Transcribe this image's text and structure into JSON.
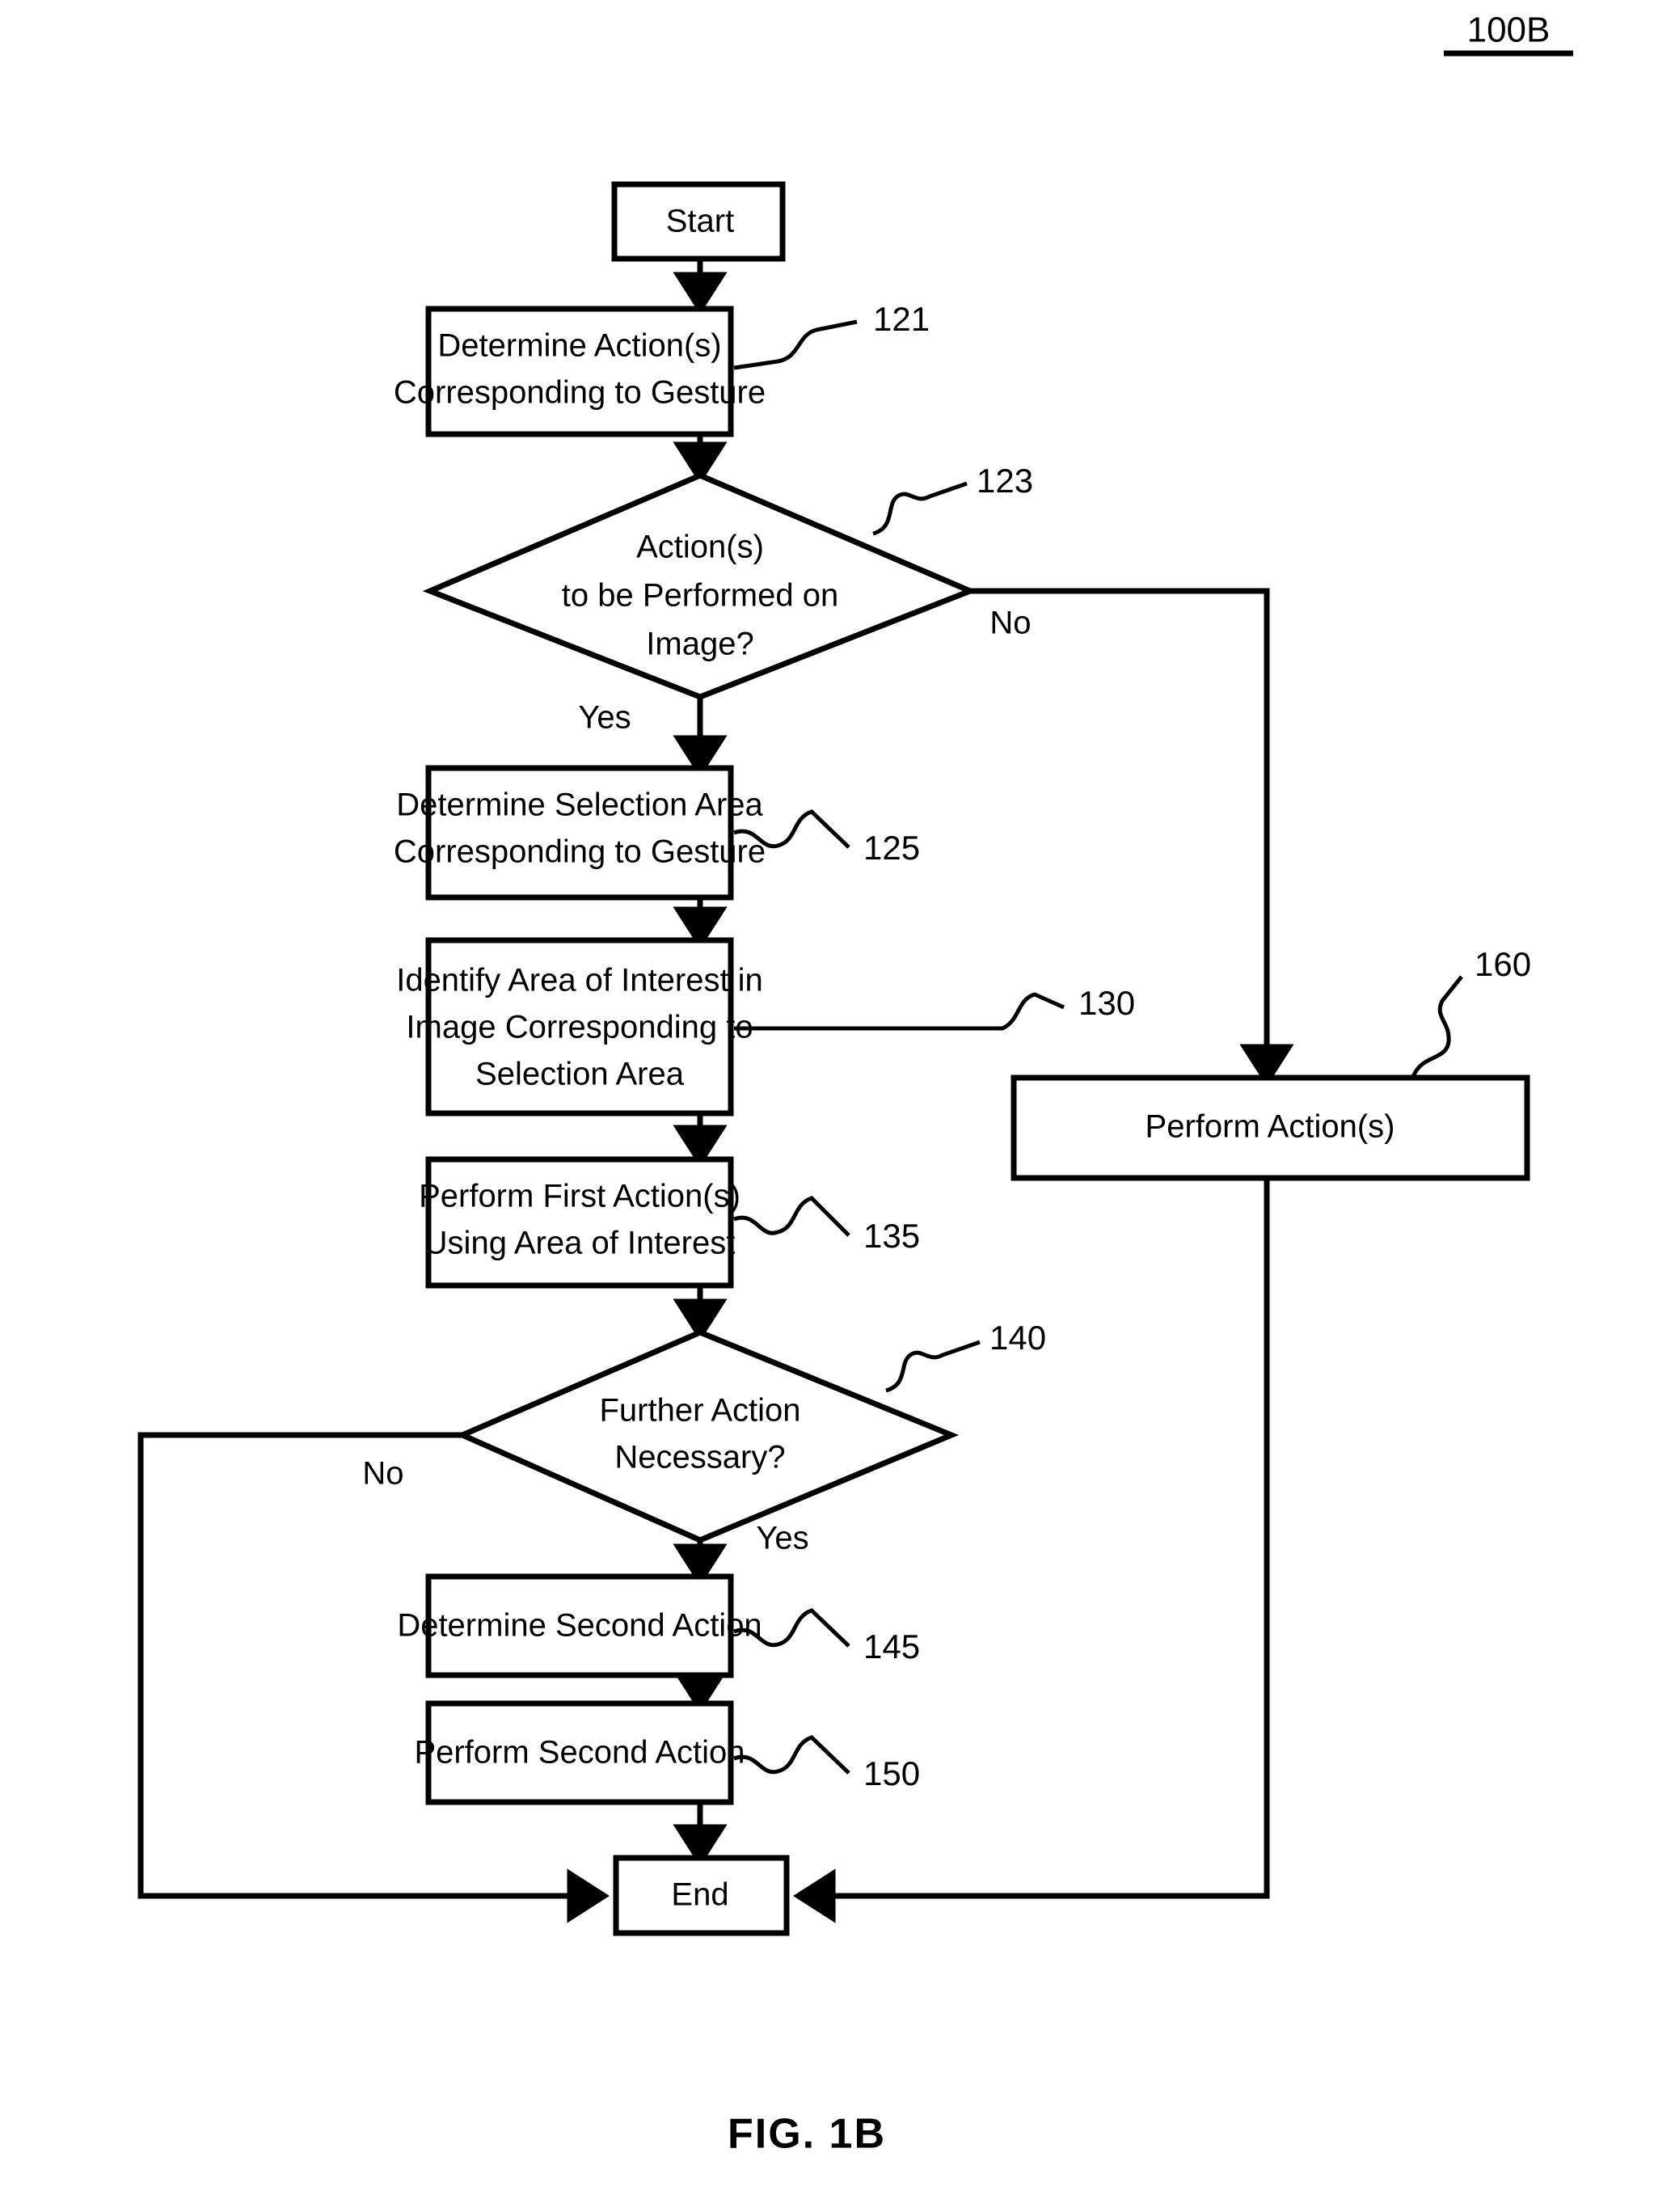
{
  "figure": {
    "id_label": "100B",
    "caption": "FIG. 1B"
  },
  "nodes": {
    "start": {
      "label": "Start",
      "shape": "rect"
    },
    "n121": {
      "label_line1": "Determine Action(s)",
      "label_line2": "Corresponding to Gesture",
      "ref": "121",
      "shape": "rect"
    },
    "n123": {
      "label_line1": "Action(s)",
      "label_line2": "to be Performed on",
      "label_line3": "Image?",
      "ref": "123",
      "shape": "diamond"
    },
    "n125": {
      "label_line1": "Determine Selection Area",
      "label_line2": "Corresponding to Gesture",
      "ref": "125",
      "shape": "rect"
    },
    "n130": {
      "label_line1": "Identify Area of Interest in",
      "label_line2": "Image Corresponding to",
      "label_line3": "Selection Area",
      "ref": "130",
      "shape": "rect"
    },
    "n135": {
      "label_line1": "Perform First Action(s)",
      "label_line2": "Using Area of Interest",
      "ref": "135",
      "shape": "rect"
    },
    "n140": {
      "label_line1": "Further Action",
      "label_line2": "Necessary?",
      "ref": "140",
      "shape": "diamond"
    },
    "n145": {
      "label": "Determine Second Action",
      "ref": "145",
      "shape": "rect"
    },
    "n150": {
      "label": "Perform Second Action",
      "ref": "150",
      "shape": "rect"
    },
    "n160": {
      "label": "Perform Action(s)",
      "ref": "160",
      "shape": "rect"
    },
    "end": {
      "label": "End",
      "shape": "rect"
    }
  },
  "branch_labels": {
    "d123_no": "No",
    "d123_yes": "Yes",
    "d140_no": "No",
    "d140_yes": "Yes"
  },
  "colors": {
    "stroke": "#000000",
    "fill": "#ffffff",
    "background": "#ffffff"
  }
}
